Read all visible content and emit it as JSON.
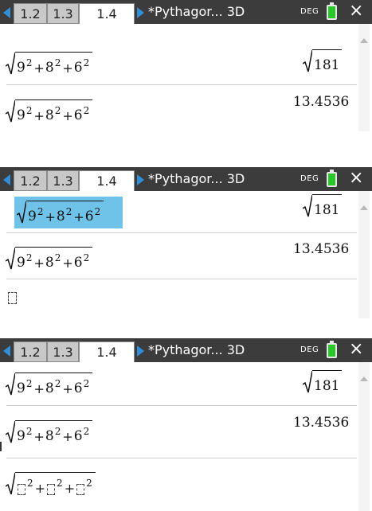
{
  "header": {
    "tabs": [
      {
        "label": "1.2",
        "active": false
      },
      {
        "label": "1.3",
        "active": false
      },
      {
        "label": "1.4",
        "active": true
      }
    ],
    "doc_title": "*Pythagor... 3D",
    "angle_mode": "DEG",
    "close_glyph": "×"
  },
  "calc": {
    "entry1": {
      "base1": "9",
      "base2": "8",
      "base3": "6",
      "exp": "2",
      "result": "181"
    },
    "entry2": {
      "base1": "9",
      "base2": "8",
      "base3": "6",
      "exp": "2",
      "result": "13.4536"
    },
    "template_exp": "2"
  },
  "colors": {
    "titlebar": "#3c3c3c",
    "tab_arrow": "#2f8fd8",
    "battery": "#28c828",
    "selection": "#6fc3e8"
  }
}
